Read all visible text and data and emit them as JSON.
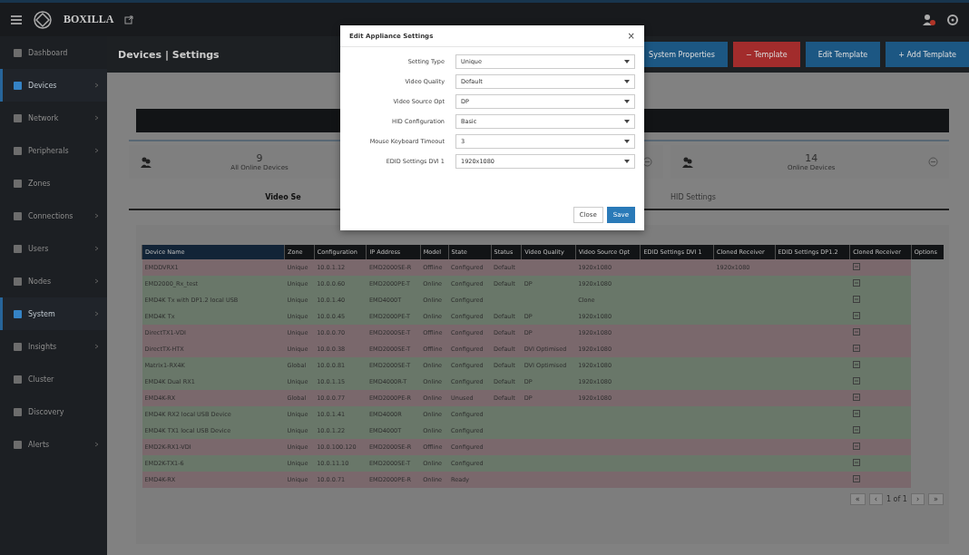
{
  "brand": {
    "name": "BOXILLA"
  },
  "sidebar": {
    "items": [
      {
        "label": "Dashboard",
        "selected": false,
        "expandable": false
      },
      {
        "label": "Devices",
        "selected": true,
        "expandable": true
      },
      {
        "label": "Network",
        "selected": false,
        "expandable": true
      },
      {
        "label": "Peripherals",
        "selected": false,
        "expandable": true
      },
      {
        "label": "Zones",
        "selected": false,
        "expandable": false
      },
      {
        "label": "Connections",
        "selected": false,
        "expandable": true
      },
      {
        "label": "Users",
        "selected": false,
        "expandable": true
      },
      {
        "label": "Nodes",
        "selected": false,
        "expandable": true
      },
      {
        "label": "System",
        "selected": true,
        "expandable": true
      },
      {
        "label": "Insights",
        "selected": false,
        "expandable": true
      },
      {
        "label": "Cluster",
        "selected": false,
        "expandable": false
      },
      {
        "label": "Discovery",
        "selected": false,
        "expandable": false
      },
      {
        "label": "Alerts",
        "selected": false,
        "expandable": true
      }
    ]
  },
  "page_header": {
    "title": "Devices | Settings",
    "buttons": [
      {
        "label": "System Properties",
        "kind": "primary"
      },
      {
        "label": "− Template",
        "kind": "danger"
      },
      {
        "label": "Edit Template",
        "kind": "primary"
      },
      {
        "label": "+ Add Template",
        "kind": "primary"
      }
    ]
  },
  "stats": [
    {
      "value": "9",
      "label": "All Online Devices"
    },
    {
      "value": "14",
      "label": "Online Devices"
    }
  ],
  "tabs": [
    {
      "label": "Video Se",
      "selected": true
    },
    {
      "label": "HID Settings",
      "selected": false
    }
  ],
  "table": {
    "columns": [
      "Device Name",
      "Zone",
      "Configuration",
      "IP Address",
      "Model",
      "State",
      "Status",
      "Video Quality",
      "Video Source Opt",
      "EDID Settings DVI 1",
      "Cloned Receiver",
      "EDID Settings DP1.2",
      "Cloned Receiver",
      "Options"
    ],
    "rows": [
      {
        "online": false,
        "cells": [
          "EMDDVRX1",
          "Unique",
          "10.0.1.12",
          "EMD2000SE-R",
          "Offline",
          "Configured",
          "Default",
          null,
          "1920x1080",
          null,
          "1920x1080",
          null
        ]
      },
      {
        "online": true,
        "cells": [
          "EMD2000_Rx_test",
          "Unique",
          "10.0.0.60",
          "EMD2000PE-T",
          "Online",
          "Configured",
          "Default",
          "DP",
          "1920x1080",
          null,
          null,
          null
        ]
      },
      {
        "online": true,
        "cells": [
          "EMD4K Tx with DP1.2 local USB",
          "Unique",
          "10.0.1.40",
          "EMD4000T",
          "Online",
          "Configured",
          null,
          null,
          "Clone",
          null,
          null,
          null
        ]
      },
      {
        "online": true,
        "cells": [
          "EMD4K Tx",
          "Unique",
          "10.0.0.45",
          "EMD2000PE-T",
          "Online",
          "Configured",
          "Default",
          "DP",
          "1920x1080",
          null,
          null,
          null
        ]
      },
      {
        "online": false,
        "cells": [
          "DirectTX1-VDI",
          "Unique",
          "10.0.0.70",
          "EMD2000SE-T",
          "Offline",
          "Configured",
          "Default",
          "DP",
          "1920x1080",
          null,
          null,
          null
        ]
      },
      {
        "online": false,
        "cells": [
          "DirectTX-HTX",
          "Unique",
          "10.0.0.38",
          "EMD2000SE-T",
          "Offline",
          "Configured",
          "Default",
          "DVI Optimised",
          "1920x1080",
          null,
          null,
          null
        ]
      },
      {
        "online": true,
        "cells": [
          "Matrix1-RX4K",
          "Global",
          "10.0.0.81",
          "EMD2000SE-T",
          "Online",
          "Configured",
          "Default",
          "DVI Optimised",
          "1920x1080",
          null,
          null,
          null
        ]
      },
      {
        "online": true,
        "cells": [
          "EMD4K Dual RX1",
          "Unique",
          "10.0.1.15",
          "EMD4000R-T",
          "Online",
          "Configured",
          "Default",
          "DP",
          "1920x1080",
          null,
          null,
          null
        ]
      },
      {
        "online": false,
        "cells": [
          "EMD4K-RX",
          "Global",
          "10.0.0.77",
          "EMD2000PE-R",
          "Online",
          "Unused",
          "Default",
          "DP",
          "1920x1080",
          null,
          null,
          null
        ]
      },
      {
        "online": true,
        "cells": [
          "EMD4K RX2 local USB Device",
          "Unique",
          "10.0.1.41",
          "EMD4000R",
          "Online",
          "Configured",
          null,
          null,
          null,
          null,
          null,
          null
        ]
      },
      {
        "online": true,
        "cells": [
          "EMD4K TX1 local USB Device",
          "Unique",
          "10.0.1.22",
          "EMD4000T",
          "Online",
          "Configured",
          null,
          null,
          null,
          null,
          null,
          null
        ]
      },
      {
        "online": false,
        "cells": [
          "EMD2K-RX1-VDI",
          "Unique",
          "10.0.100.120",
          "EMD2000SE-R",
          "Offline",
          "Configured",
          null,
          null,
          null,
          null,
          null,
          null
        ]
      },
      {
        "online": true,
        "cells": [
          "EMD2K-TX1-6",
          "Unique",
          "10.0.11.10",
          "EMD2000SE-T",
          "Online",
          "Configured",
          null,
          null,
          null,
          null,
          null,
          null
        ]
      },
      {
        "online": false,
        "cells": [
          "EMD4K-RX",
          "Unique",
          "10.0.0.71",
          "EMD2000PE-R",
          "Online",
          "Ready",
          null,
          null,
          null,
          null,
          null,
          null
        ]
      }
    ]
  },
  "pagination": {
    "first": "«",
    "prev": "‹",
    "page": "1 of 1",
    "next": "›",
    "last": "»"
  },
  "modal": {
    "title": "Edit Appliance Settings",
    "close": "×",
    "fields": [
      {
        "label": "Setting Type",
        "value": "Unique"
      },
      {
        "label": "Video Quality",
        "value": "Default"
      },
      {
        "label": "Video Source Opt",
        "value": "DP"
      },
      {
        "label": "HID Configuration",
        "value": "Basic"
      },
      {
        "label": "Mouse Keyboard Timeout",
        "value": "3"
      },
      {
        "label": "EDID Settings DVI 1",
        "value": "1920x1080"
      }
    ],
    "buttons": [
      {
        "label": "Close",
        "kind": "default"
      },
      {
        "label": "Save",
        "kind": "primary"
      }
    ]
  }
}
